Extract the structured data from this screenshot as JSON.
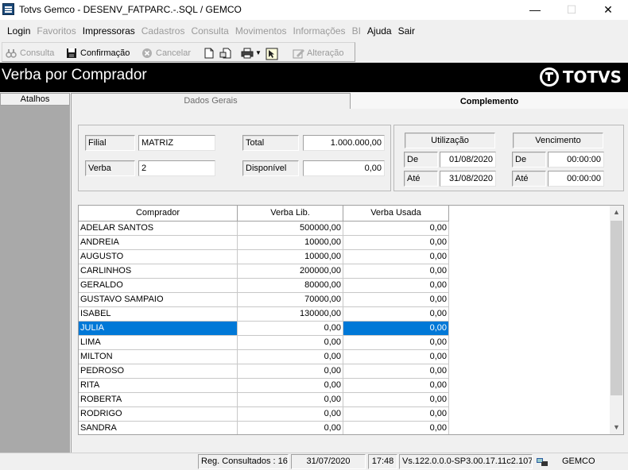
{
  "window": {
    "title": "Totvs Gemco - DESENV_FATPARC.-.SQL / GEMCO",
    "minimize": "—",
    "maximize": "☐",
    "close": "✕"
  },
  "menu": [
    {
      "label": "Login",
      "enabled": true
    },
    {
      "label": "Favoritos",
      "enabled": false
    },
    {
      "label": "Impressoras",
      "enabled": true
    },
    {
      "label": "Cadastros",
      "enabled": false
    },
    {
      "label": "Consulta",
      "enabled": false
    },
    {
      "label": "Movimentos",
      "enabled": false
    },
    {
      "label": "Informações",
      "enabled": false
    },
    {
      "label": "BI",
      "enabled": false
    },
    {
      "label": "Ajuda",
      "enabled": true
    },
    {
      "label": "Sair",
      "enabled": true
    }
  ],
  "toolbar": {
    "consulta": "Consulta",
    "confirmacao": "Confirmação",
    "cancelar": "Cancelar",
    "alteracao": "Alteração"
  },
  "header": {
    "title": "Verba por Comprador",
    "brand": "TOTVS"
  },
  "sidebar": {
    "tab_label": "Atalhos"
  },
  "tabs": {
    "dados_gerais": "Dados Gerais",
    "complemento": "Complemento"
  },
  "form": {
    "filial_label": "Filial",
    "filial_value": "MATRIZ",
    "verba_label": "Verba",
    "verba_value": "2",
    "total_label": "Total",
    "total_value": "1.000.000,00",
    "disponivel_label": "Disponível",
    "disponivel_value": "0,00"
  },
  "periods": {
    "utilizacao_label": "Utilização",
    "vencimento_label": "Vencimento",
    "de_label": "De",
    "ate_label": "Até",
    "utilizacao_de": "01/08/2020",
    "utilizacao_ate": "31/08/2020",
    "vencimento_de": "00:00:00",
    "vencimento_ate": "00:00:00"
  },
  "grid": {
    "columns": [
      "Comprador",
      "Verba Lib.",
      "Verba Usada"
    ],
    "selected_index": 7,
    "rows": [
      [
        "ADELAR SANTOS",
        "500000,00",
        "0,00"
      ],
      [
        "ANDREIA",
        "10000,00",
        "0,00"
      ],
      [
        "AUGUSTO",
        "10000,00",
        "0,00"
      ],
      [
        "CARLINHOS",
        "200000,00",
        "0,00"
      ],
      [
        "GERALDO",
        "80000,00",
        "0,00"
      ],
      [
        "GUSTAVO SAMPAIO",
        "70000,00",
        "0,00"
      ],
      [
        "ISABEL",
        "130000,00",
        "0,00"
      ],
      [
        "JULIA",
        "0,00",
        "0,00"
      ],
      [
        "LIMA",
        "0,00",
        "0,00"
      ],
      [
        "MILTON",
        "0,00",
        "0,00"
      ],
      [
        "PEDROSO",
        "0,00",
        "0,00"
      ],
      [
        "RITA",
        "0,00",
        "0,00"
      ],
      [
        "ROBERTA",
        "0,00",
        "0,00"
      ],
      [
        "RODRIGO",
        "0,00",
        "0,00"
      ],
      [
        "SANDRA",
        "0,00",
        "0,00"
      ]
    ]
  },
  "status": {
    "records": "Reg. Consultados : 16",
    "date": "31/07/2020",
    "time": "17:48",
    "version": "Vs.122.0.0.0-SP3.00.17.11c2.107",
    "company": "GEMCO"
  }
}
